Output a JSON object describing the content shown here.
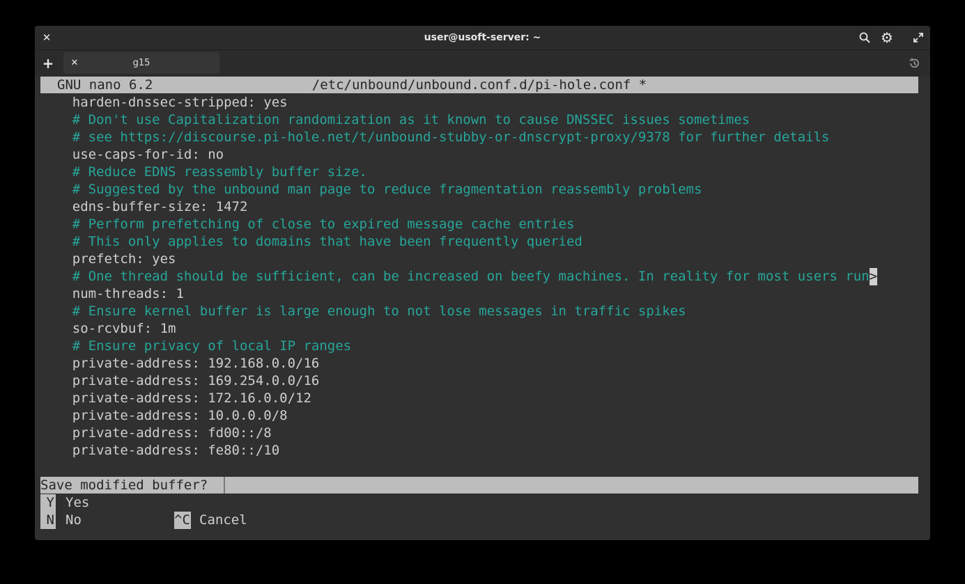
{
  "window": {
    "title": "user@usoft-server: ~",
    "close_glyph": "✕",
    "search_glyph": "⌕",
    "settings_glyph": "⚙",
    "maximize_glyph": "⤢"
  },
  "tabs": {
    "new_tab_glyph": "+",
    "close_glyph": "✕",
    "items": [
      {
        "label": "g15"
      }
    ],
    "history_glyph": "⟲"
  },
  "nano": {
    "version": "GNU nano 6.2",
    "file": "/etc/unbound/unbound.conf.d/pi-hole.conf *",
    "lines": [
      {
        "text": "    harden-dnssec-stripped: yes",
        "type": "code"
      },
      {
        "text": "    # Don't use Capitalization randomization as it known to cause DNSSEC issues sometimes",
        "type": "comment"
      },
      {
        "text": "    # see https://discourse.pi-hole.net/t/unbound-stubby-or-dnscrypt-proxy/9378 for further details",
        "type": "comment"
      },
      {
        "text": "    use-caps-for-id: no",
        "type": "code"
      },
      {
        "text": "    # Reduce EDNS reassembly buffer size.",
        "type": "comment"
      },
      {
        "text": "    # Suggested by the unbound man page to reduce fragmentation reassembly problems",
        "type": "comment"
      },
      {
        "text": "    edns-buffer-size: 1472",
        "type": "code"
      },
      {
        "text": "    # Perform prefetching of close to expired message cache entries",
        "type": "comment"
      },
      {
        "text": "    # This only applies to domains that have been frequently queried",
        "type": "comment"
      },
      {
        "text": "    prefetch: yes",
        "type": "code"
      },
      {
        "text": "    # One thread should be sufficient, can be increased on beefy machines. In reality for most users run",
        "type": "comment",
        "truncated": ">"
      },
      {
        "text": "    num-threads: 1",
        "type": "code"
      },
      {
        "text": "    # Ensure kernel buffer is large enough to not lose messages in traffic spikes",
        "type": "comment"
      },
      {
        "text": "    so-rcvbuf: 1m",
        "type": "code"
      },
      {
        "text": "    # Ensure privacy of local IP ranges",
        "type": "comment"
      },
      {
        "text": "    private-address: 192.168.0.0/16",
        "type": "code"
      },
      {
        "text": "    private-address: 169.254.0.0/16",
        "type": "code"
      },
      {
        "text": "    private-address: 172.16.0.0/12",
        "type": "code"
      },
      {
        "text": "    private-address: 10.0.0.0/8",
        "type": "code"
      },
      {
        "text": "    private-address: fd00::/8",
        "type": "code"
      },
      {
        "text": "    private-address: fe80::/10",
        "type": "code"
      }
    ],
    "prompt": "Save modified buffer?",
    "options": [
      {
        "key": "Y",
        "label": "Yes"
      },
      {
        "key": "N",
        "label": "No"
      },
      {
        "key": "^C",
        "label": "Cancel"
      }
    ]
  },
  "colors": {
    "comment": "#26a69a",
    "code": "#cfcfcf",
    "bar": "#bdbdbd",
    "background": "#303030"
  }
}
